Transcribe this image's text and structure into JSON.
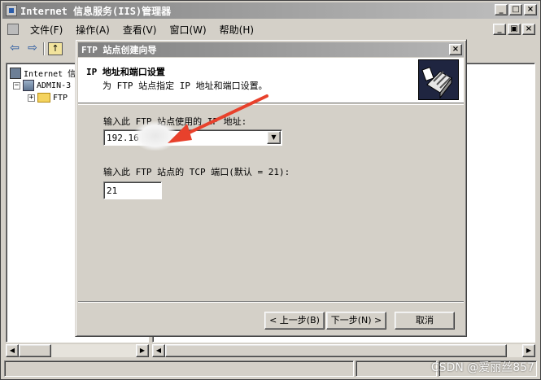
{
  "app": {
    "title": "Internet 信息服务(IIS)管理器",
    "min_glyph": "_",
    "max_glyph": "□",
    "close_glyph": "×"
  },
  "menu": {
    "file": "文件(F)",
    "action": "操作(A)",
    "view": "查看(V)",
    "window": "窗口(W)",
    "help": "帮助(H)"
  },
  "mdi_buttons": {
    "min": "_",
    "restore": "▣",
    "close": "×"
  },
  "toolbar": {
    "back": "⇦",
    "forward": "⇨",
    "up": "↑"
  },
  "tree": {
    "root_label": "Internet 信",
    "server_label": "ADMIN-3",
    "server_expander": "−",
    "ftp_label": "FTP",
    "ftp_expander": "+"
  },
  "dialog": {
    "title": "FTP 站点创建向导",
    "close": "×",
    "header_title": "IP 地址和端口设置",
    "header_subtitle": "为 FTP 站点指定 IP 地址和端口设置。",
    "ip_label": "输入此 FTP 站点使用的 IP 地址:",
    "ip_value": "192.16",
    "port_label": "输入此 FTP 站点的 TCP 端口(默认 = 21):",
    "port_value": "21",
    "back_button": "< 上一步(B)",
    "next_button": "下一步(N) >",
    "cancel_button": "取消"
  },
  "watermark": "CSDN @爱丽丝857",
  "colors": {
    "arrow": "#e8412c",
    "titlebar_inactive": "#808080",
    "face": "#d4d0c8"
  }
}
